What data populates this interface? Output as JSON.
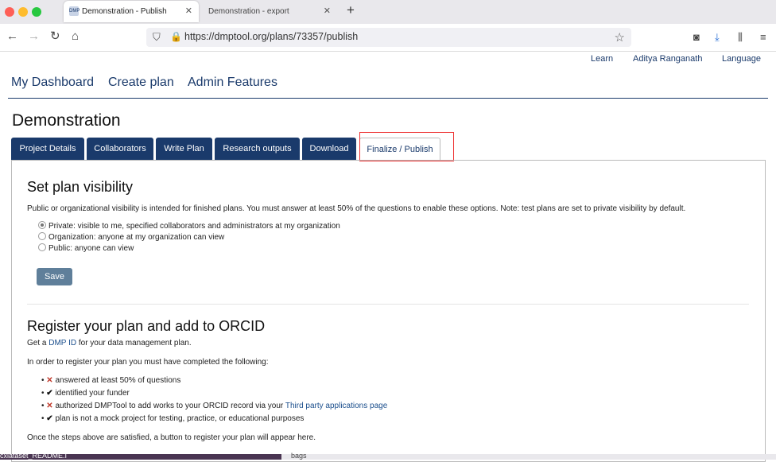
{
  "browser": {
    "active_tab": "Demonstration - Publish",
    "inactive_tab": "Demonstration - export",
    "url": "https://dmptool.org/plans/73357/publish"
  },
  "header": {
    "learn": "Learn",
    "user": "Aditya Ranganath",
    "language": "Language"
  },
  "mainnav": [
    "My Dashboard",
    "Create plan",
    "Admin Features"
  ],
  "page_title": "Demonstration",
  "tabs": [
    "Project Details",
    "Collaborators",
    "Write Plan",
    "Research outputs",
    "Download",
    "Finalize / Publish"
  ],
  "visibility": {
    "heading": "Set plan visibility",
    "intro": "Public or organizational visibility is intended for finished plans. You must answer at least 50% of the questions to enable these options. Note: test plans are set to private visibility by default.",
    "options": [
      "Private: visible to me, specified collaborators and administrators at my organization",
      "Organization: anyone at my organization can view",
      "Public: anyone can view"
    ],
    "save": "Save"
  },
  "orcid": {
    "heading": "Register your plan and add to ORCID",
    "get_a": "Get a",
    "dmp_id": "DMP ID",
    "get_rest": "for your data management plan.",
    "requirements_intro": "In order to register your plan you must have completed the following:",
    "items": [
      {
        "status": "x",
        "text": "answered at least 50% of questions"
      },
      {
        "status": "ok",
        "text": "identified your funder"
      },
      {
        "status": "x",
        "text": "authorized DMPTool to add works to your ORCID record via your",
        "link": "Third party applications page"
      },
      {
        "status": "ok",
        "text": "plan is not a mock project for testing, practice, or educational purposes"
      }
    ],
    "footer": "Once the steps above are satisfied, a button to register your plan will appear here."
  },
  "bottom_bar": {
    "left": "cxlataset_README.I",
    "right": "bags"
  }
}
